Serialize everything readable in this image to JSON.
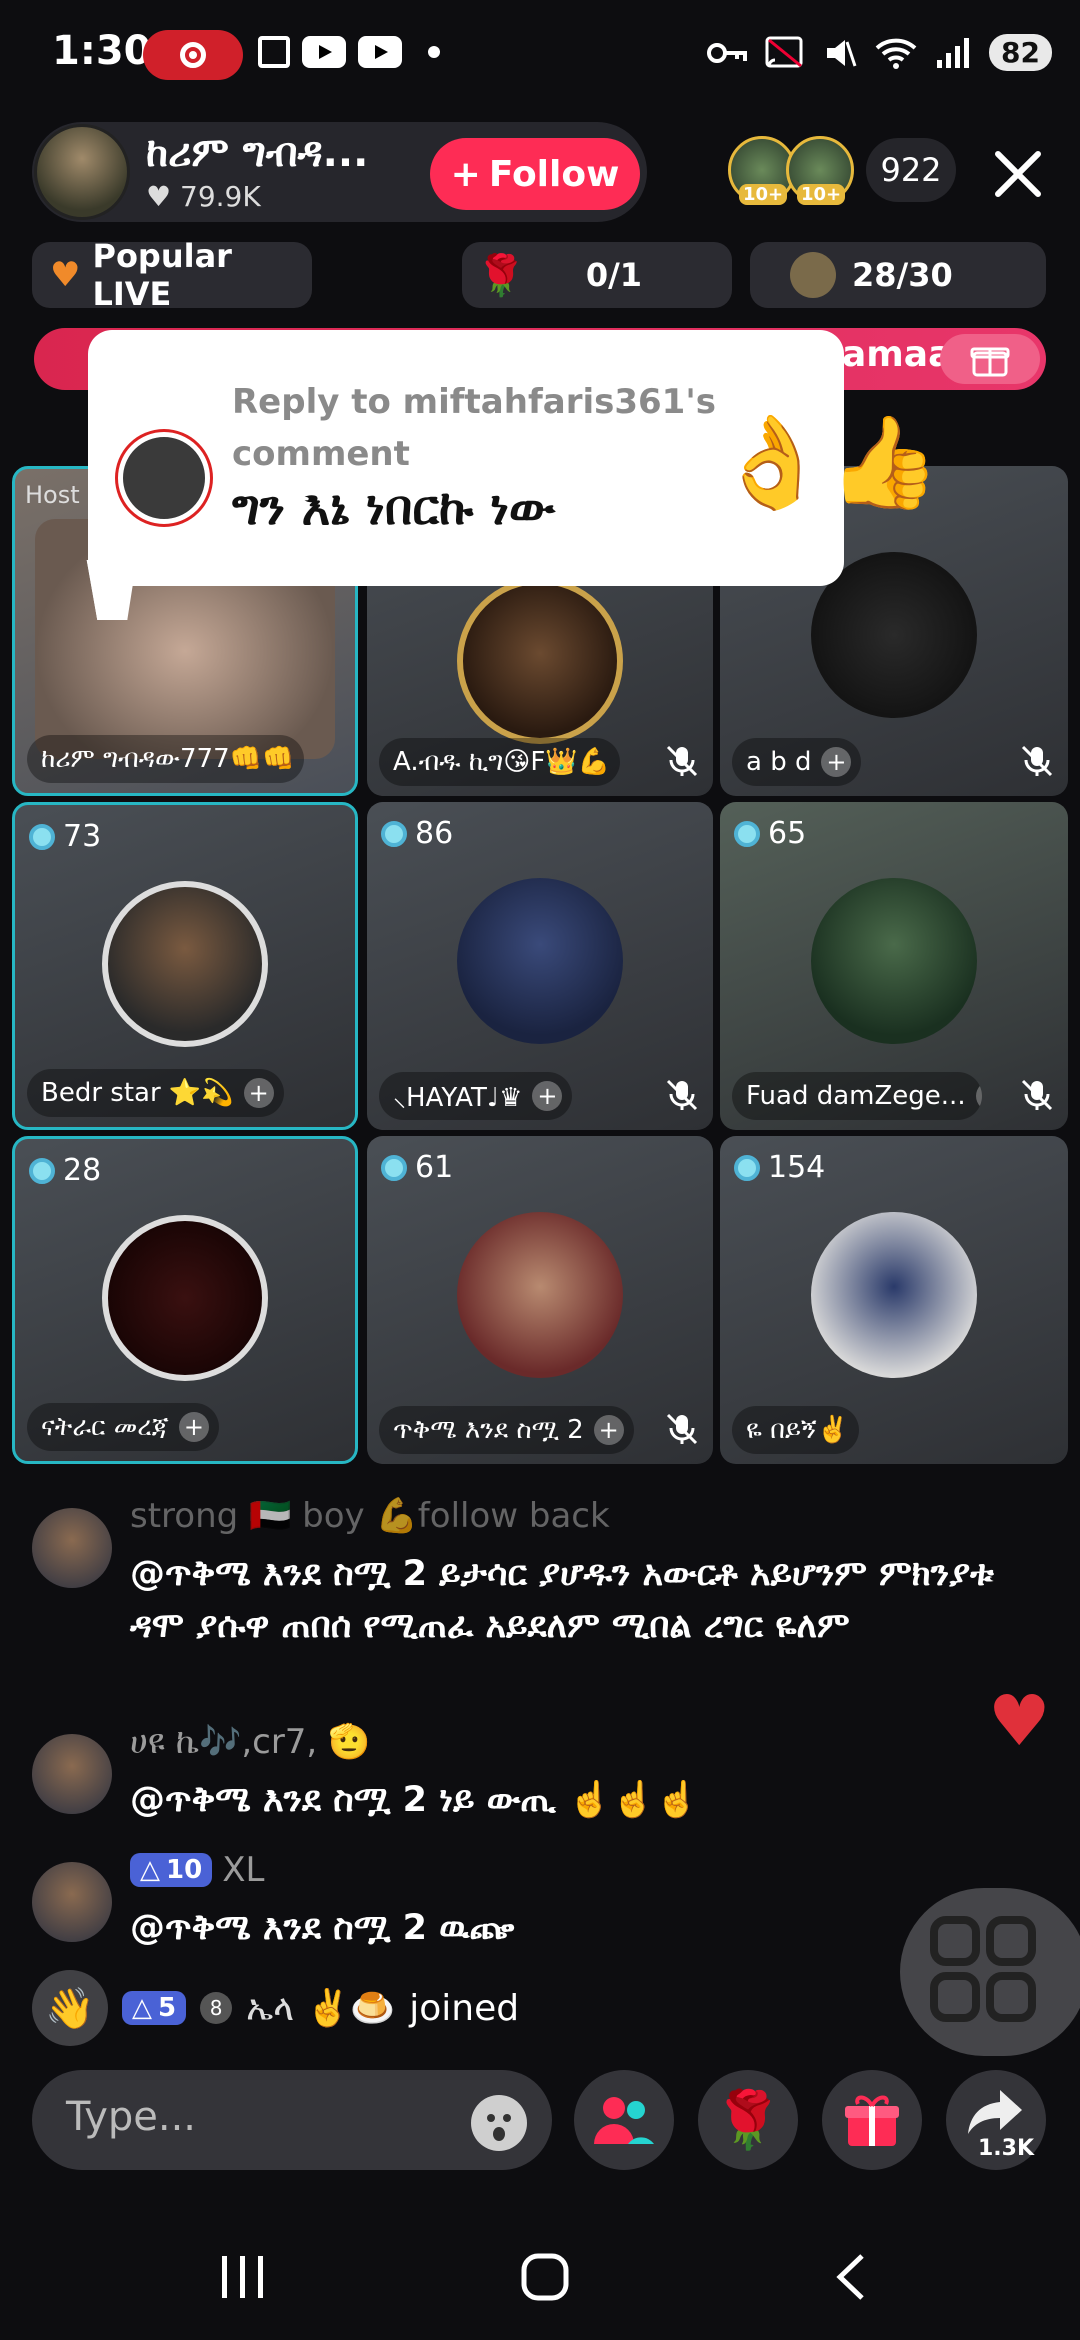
{
  "status": {
    "time": "1:30",
    "battery": "82"
  },
  "header": {
    "host_name": "ከሪም ግብዳ...",
    "likes": "79.9K",
    "follow_label": "Follow",
    "viewer_badges": [
      "10+",
      "10+"
    ],
    "viewer_count": "922"
  },
  "chips": {
    "popular": "Popular LIVE",
    "rose_progress": "0/1",
    "goal_progress": "28/30"
  },
  "banner": {
    "text": "amaa"
  },
  "popup": {
    "reply": "Reply to miftahfaris361's comment",
    "text": "ግን እኔ ነበርኩ ነው",
    "emoji": "👌👍"
  },
  "grid": {
    "host_tag": "Host",
    "tiles": [
      {
        "name": "ከሪም ግብዳው777👊👊",
        "score": ""
      },
      {
        "name": "A.ብዱ ኪግ😘F👑💪",
        "score": ""
      },
      {
        "name": "a b d",
        "score": ""
      },
      {
        "name": "Bedr star ⭐💫",
        "score": "73"
      },
      {
        "name": "⸜HAYAT♩♛",
        "score": "86"
      },
      {
        "name": "Fuad damZege...",
        "score": "65"
      },
      {
        "name": "ናትራር መረጃ",
        "score": "28"
      },
      {
        "name": "ጥቅሜ እንደ ስሟ 2",
        "score": "61"
      },
      {
        "name": "ዬ በይኝ✌️",
        "score": "154"
      }
    ]
  },
  "chat": {
    "messages": [
      {
        "user": "strong 🇦🇪 boy 💪follow back",
        "text": "@ጥቅሜ እንደ ስሟ 2 ይታሳር ያሆዱን አውርቶ አይሆንም ምክንያቱ ዳሞ ያሱዋ ጠበሰ የሚጠፈ አይደለም ሚበል ረግር ዬለም"
      },
      {
        "user": "ሀዩ ኬ🎶,cr7, 🫡",
        "text": "@ጥቅሜ እንደ ስሟ 2  ነይ ውጢ ☝️☝️☝️"
      },
      {
        "user": "XL",
        "level": "10",
        "text": "@ጥቅሜ እንደ ስሟ 2 ዉጬ"
      }
    ],
    "join": {
      "level": "5",
      "rank": "8",
      "user": "ኤላ ✌️🍮",
      "text": "joined"
    }
  },
  "input": {
    "placeholder": "Type..."
  },
  "share": {
    "count": "1.3K"
  }
}
